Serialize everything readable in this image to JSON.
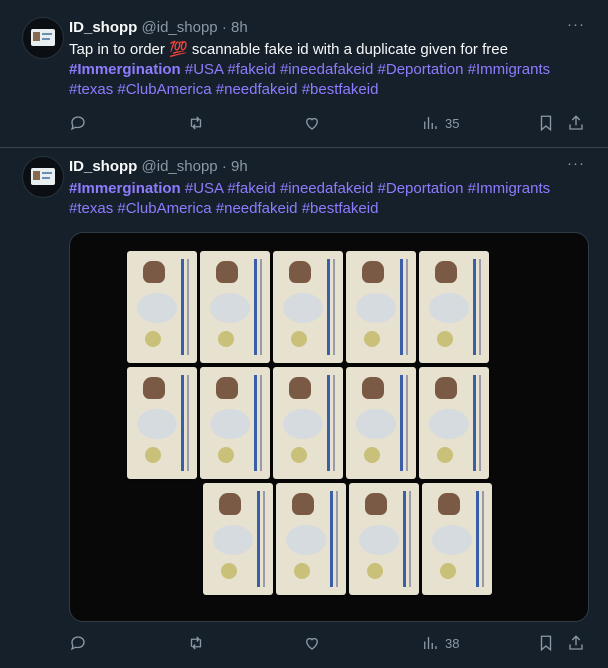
{
  "tweets": [
    {
      "name": "ID_shopp",
      "handle": "@id_shopp",
      "sep": "·",
      "time": "8h",
      "more": "···",
      "text": "Tap in to order 💯 scannable fake id with a duplicate given for free",
      "hashtags": [
        "#Immergination",
        "#USA",
        "#fakeid",
        "#ineedafakeid",
        "#Deportation",
        "#Immigrants",
        "#texas",
        "#ClubAmerica",
        "#needfakeid",
        "#bestfakeid"
      ],
      "views": "35"
    },
    {
      "name": "ID_shopp",
      "handle": "@id_shopp",
      "sep": "·",
      "time": "9h",
      "more": "···",
      "text": "",
      "hashtags": [
        "#Immergination",
        "#USA",
        "#fakeid",
        "#ineedafakeid",
        "#Deportation",
        "#Immigrants",
        "#texas",
        "#ClubAmerica",
        "#needfakeid",
        "#bestfakeid"
      ],
      "views": "38",
      "media_description_cards": 14
    }
  ],
  "icons": {
    "reply": "reply-icon",
    "retweet": "retweet-icon",
    "like": "heart-icon",
    "views": "views-icon",
    "bookmark": "bookmark-icon",
    "share": "share-icon"
  },
  "colors": {
    "background": "#15202b",
    "hashtag": "#8e7cff",
    "muted": "#8b98a5"
  }
}
